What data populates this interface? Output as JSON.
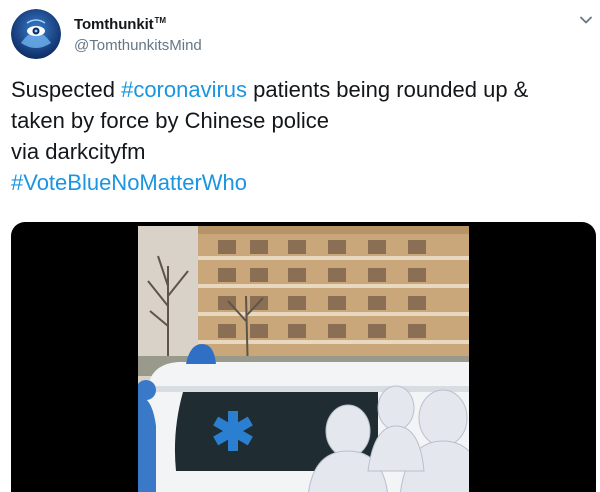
{
  "tweet": {
    "author": {
      "display_name": "Tomthunkit",
      "display_name_mark": "TM",
      "handle": "@TomthunkitsMind",
      "avatar_icon": "third-eye-avatar-icon"
    },
    "menu_icon": "chevron-down-icon",
    "text": {
      "line1_prefix": "Suspected ",
      "line1_hashtag": "#coronavirus",
      "line1_suffix": " patients being rounded up &",
      "line2": "taken by force by Chinese police",
      "line3": "via darkcityfm",
      "line4_hashtag": "#VoteBlueNoMatterWho"
    },
    "media": {
      "type": "video",
      "scene": "ambulance-with-hazmat-workers"
    },
    "colors": {
      "hashtag": "#1b95e0",
      "name": "#14171a",
      "handle": "#657786"
    }
  }
}
